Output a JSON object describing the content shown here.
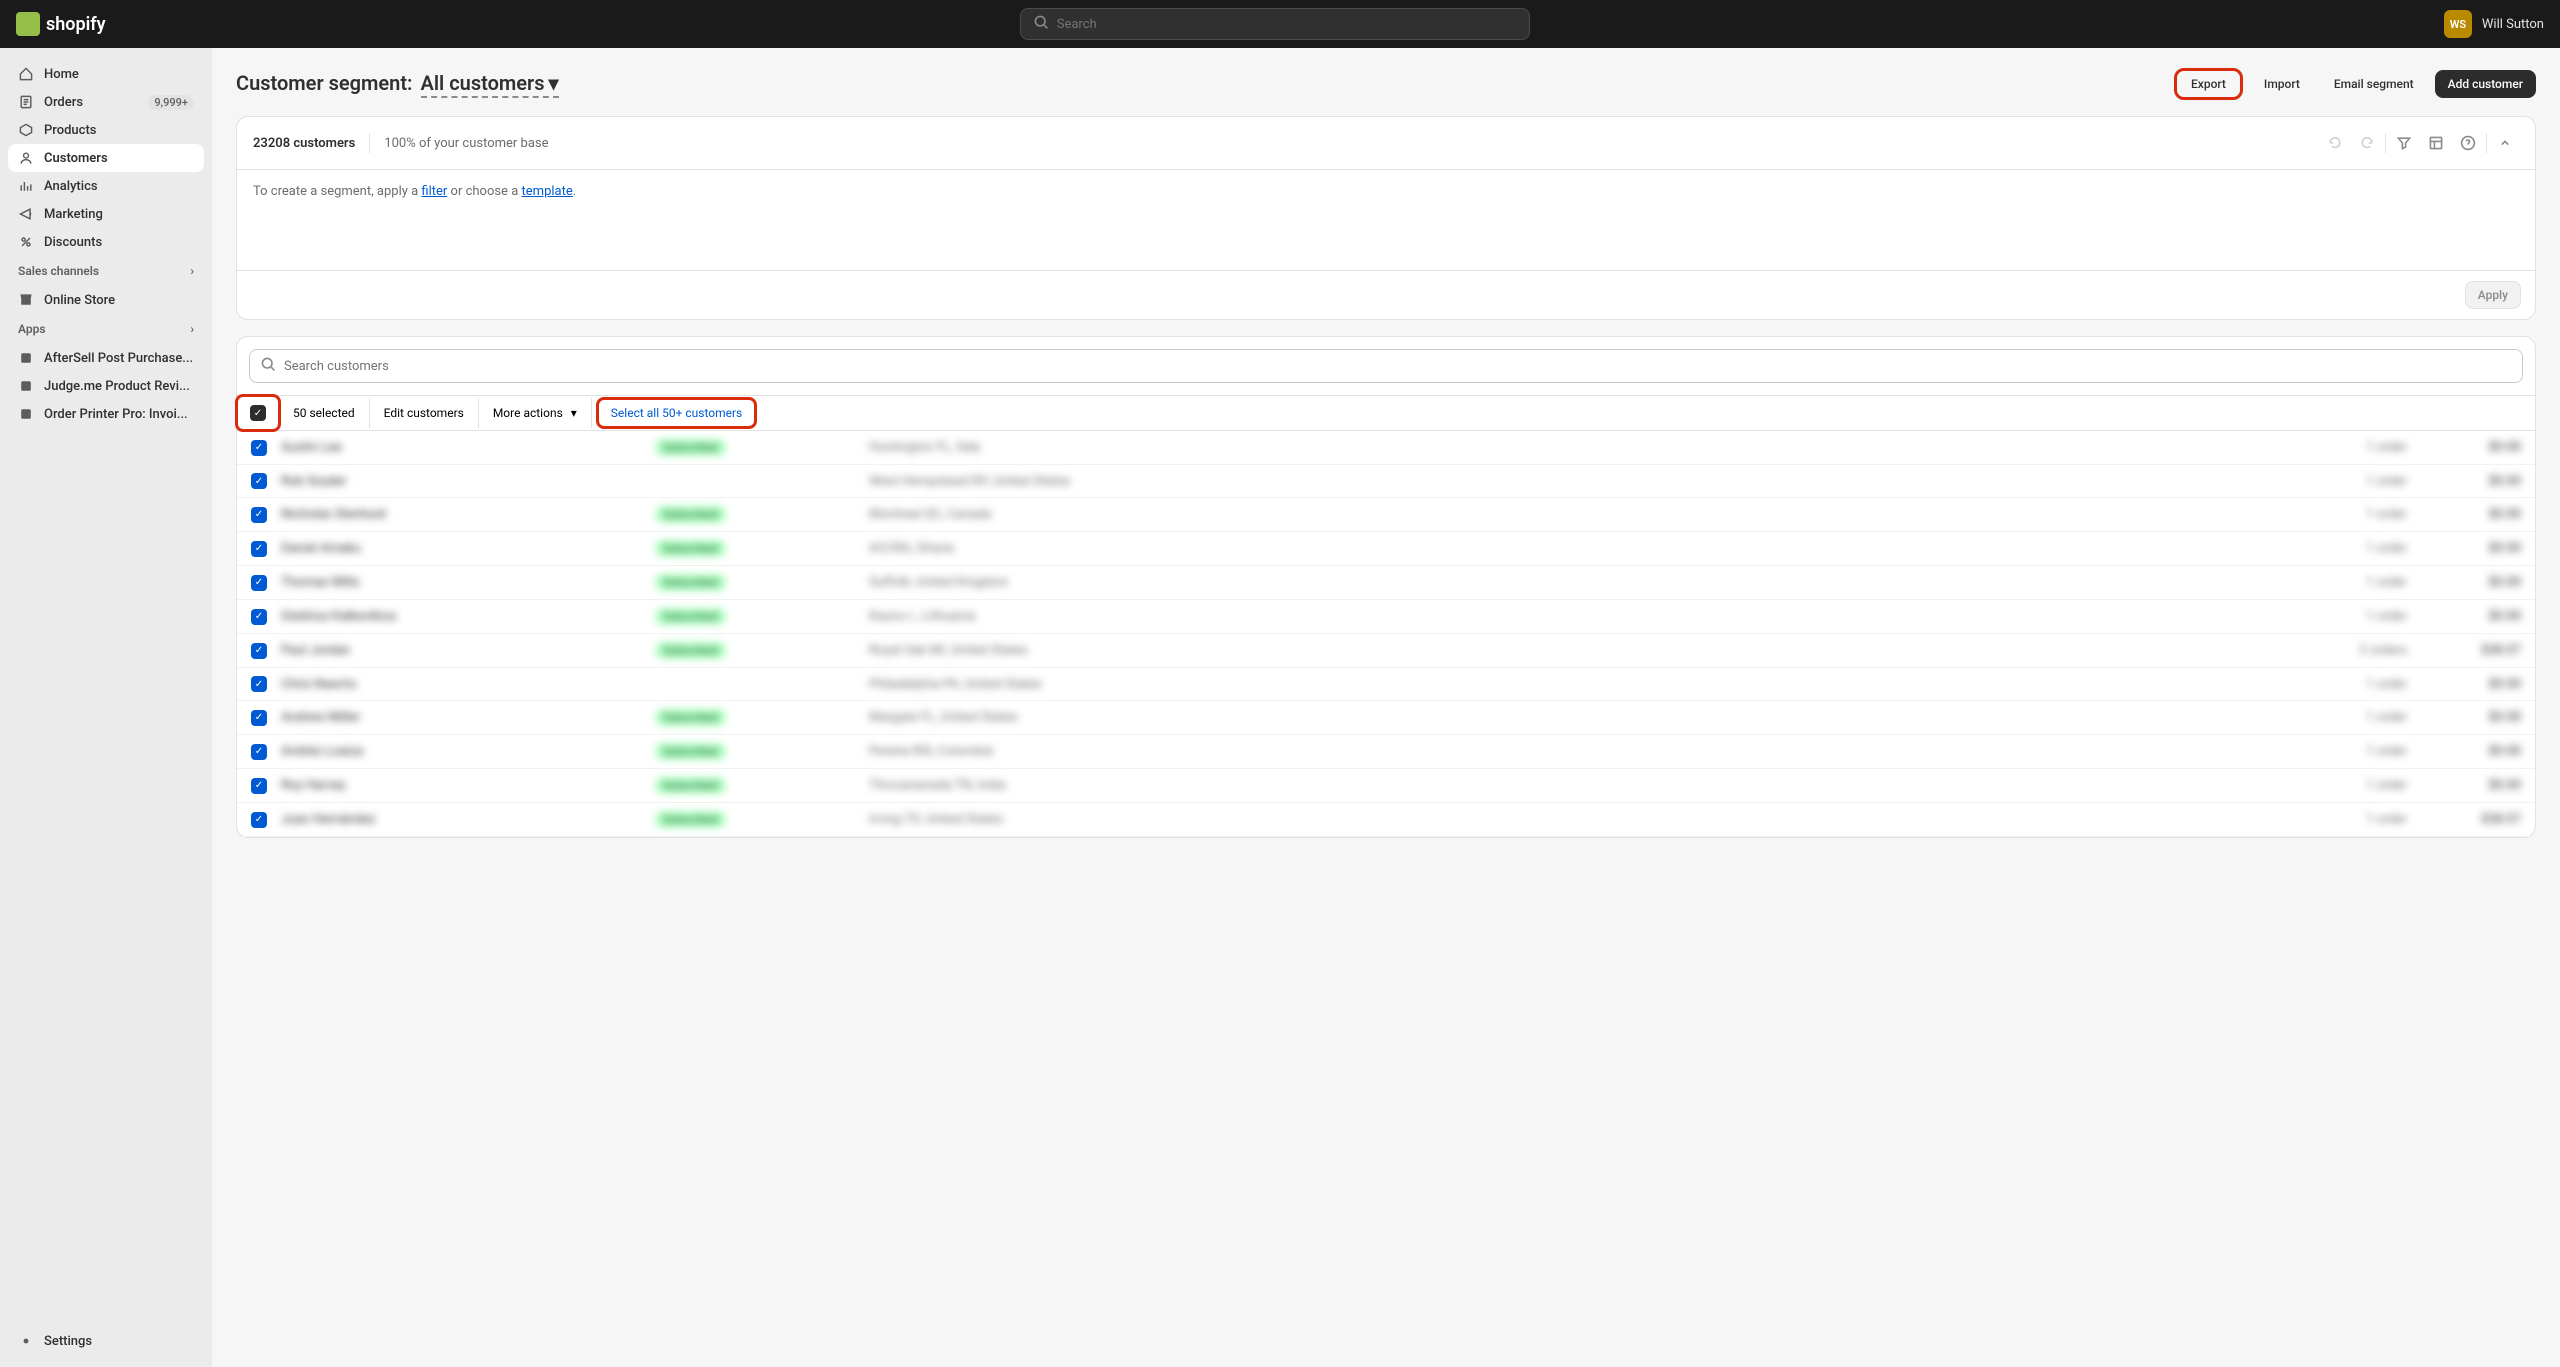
{
  "topbar": {
    "logo_text": "shopify",
    "search_placeholder": "Search",
    "user_initials": "WS",
    "user_name": "Will Sutton"
  },
  "sidebar": {
    "items": [
      {
        "label": "Home",
        "icon": "home"
      },
      {
        "label": "Orders",
        "icon": "orders",
        "badge": "9,999+"
      },
      {
        "label": "Products",
        "icon": "products"
      },
      {
        "label": "Customers",
        "icon": "customers",
        "active": true
      },
      {
        "label": "Analytics",
        "icon": "analytics"
      },
      {
        "label": "Marketing",
        "icon": "marketing"
      },
      {
        "label": "Discounts",
        "icon": "discounts"
      }
    ],
    "sales_channels_label": "Sales channels",
    "online_store_label": "Online Store",
    "apps_label": "Apps",
    "apps": [
      {
        "label": "AfterSell Post Purchase..."
      },
      {
        "label": "Judge.me Product Revi..."
      },
      {
        "label": "Order Printer Pro: Invoi..."
      }
    ],
    "settings_label": "Settings"
  },
  "page": {
    "title_prefix": "Customer segment:",
    "segment_name": "All customers",
    "actions": {
      "export": "Export",
      "import": "Import",
      "email_segment": "Email segment",
      "add_customer": "Add customer"
    }
  },
  "segment_card": {
    "count": "23208 customers",
    "percent": "100% of your customer base",
    "editor_prefix": "To create a segment, apply a ",
    "filter_link": "filter",
    "editor_mid": " or choose a ",
    "template_link": "template",
    "editor_suffix": ".",
    "apply_label": "Apply"
  },
  "table": {
    "search_placeholder": "Search customers",
    "selected_label": "50 selected",
    "edit_label": "Edit customers",
    "more_actions_label": "More actions",
    "select_all_label": "Select all 50+ customers",
    "rows": [
      {
        "name": "Austin Lee",
        "status": "Subscribed",
        "loc": "Huntington FL, Italy",
        "orders": "1 order",
        "amt": "$0.00"
      },
      {
        "name": "Rob Snyder",
        "status": "",
        "loc": "West Hempstead NY, United States",
        "orders": "1 order",
        "amt": "$0.00"
      },
      {
        "name": "Nicholas Stenhuid",
        "status": "Subscribed",
        "loc": "Montreal QC, Canada",
        "orders": "1 order",
        "amt": "$0.00"
      },
      {
        "name": "Daniel Amaku",
        "status": "Subscribed",
        "loc": "ACCRA, Ghana",
        "orders": "1 order",
        "amt": "$0.00"
      },
      {
        "name": "Thomas Mills",
        "status": "Subscribed",
        "loc": "Suffolk, United Kingdom",
        "orders": "1 order",
        "amt": "$0.00"
      },
      {
        "name": "Giedrius Kalkevikius",
        "status": "Subscribed",
        "loc": "Kauno r., Lithuania",
        "orders": "1 order",
        "amt": "$0.00"
      },
      {
        "name": "Paul Jordan",
        "status": "Subscribed",
        "loc": "Royal Oak MI, United States",
        "orders": "2 orders",
        "amt": "$38.07"
      },
      {
        "name": "Chris Nawrto",
        "status": "",
        "loc": "Philadelphia PA, United States",
        "orders": "1 order",
        "amt": "$0.00"
      },
      {
        "name": "Andrew Miller",
        "status": "Subscribed",
        "loc": "Margate FL, United States",
        "orders": "1 order",
        "amt": "$0.00"
      },
      {
        "name": "Andrés Loaiza",
        "status": "Subscribed",
        "loc": "Pereira RIS, Colombia",
        "orders": "1 order",
        "amt": "$0.00"
      },
      {
        "name": "Roy Harvey",
        "status": "Subscribed",
        "loc": "Thruvananada TN, India",
        "orders": "1 order",
        "amt": "$0.00"
      },
      {
        "name": "Juan Hernández",
        "status": "Subscribed",
        "loc": "Irving TX, United States",
        "orders": "1 order",
        "amt": "$38.07"
      }
    ]
  }
}
